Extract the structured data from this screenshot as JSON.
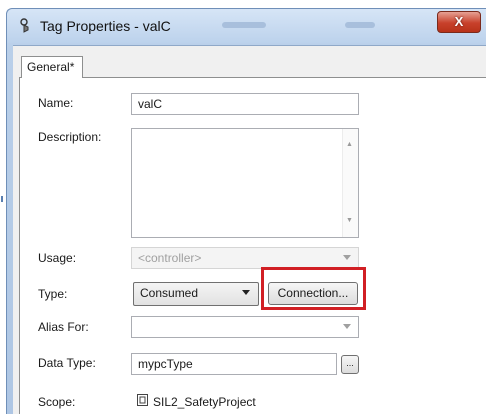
{
  "window": {
    "title": "Tag Properties - valC",
    "close_label": "X"
  },
  "tabs": [
    {
      "label": "General*"
    }
  ],
  "form": {
    "name": {
      "label": "Name:",
      "value": "valC"
    },
    "description": {
      "label": "Description:",
      "value": ""
    },
    "usage": {
      "label": "Usage:",
      "value": "<controller>"
    },
    "type": {
      "label": "Type:",
      "value": "Consumed",
      "connection_label": "Connection..."
    },
    "alias_for": {
      "label": "Alias For:",
      "value": ""
    },
    "data_type": {
      "label": "Data Type:",
      "value": "mypcType",
      "browse_label": "..."
    },
    "scope": {
      "label": "Scope:",
      "value": "SIL2_SafetyProject"
    }
  },
  "colors": {
    "highlight": "#d11f24",
    "close_button": "#c8412b"
  }
}
